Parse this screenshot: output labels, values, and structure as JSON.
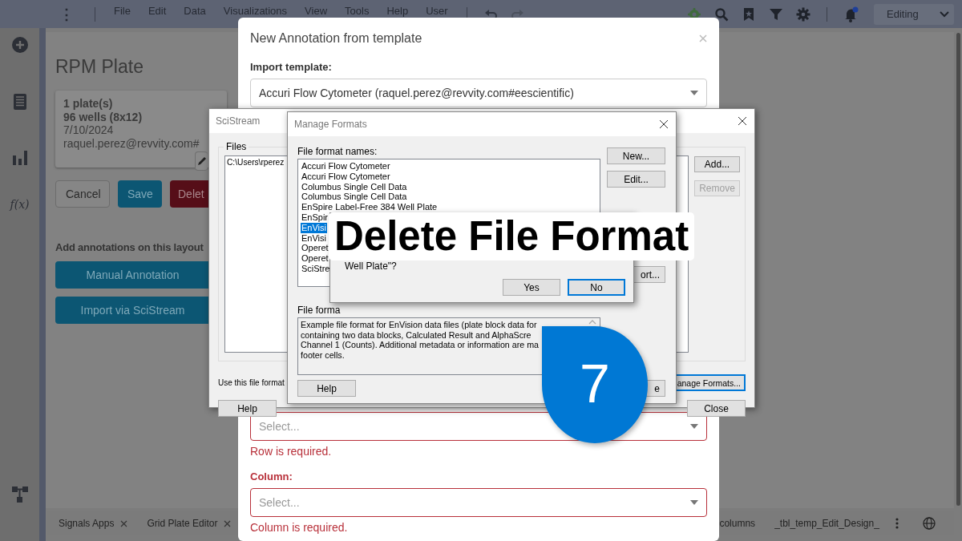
{
  "app": {
    "kebab": "⋮",
    "menu": [
      "File",
      "Edit",
      "Data",
      "Visualizations",
      "View",
      "Tools",
      "Help",
      "User"
    ],
    "mode": "Editing",
    "fx_label": "f(x)",
    "page_title": "RPM Plate",
    "summary": [
      {
        "text": "1 plate(s)",
        "bold": true
      },
      {
        "text": "96 wells (8x12)",
        "bold": true
      },
      {
        "text": "7/10/2024",
        "bold": false
      },
      {
        "text": "raquel.perez@revvity.com#",
        "bold": false
      }
    ],
    "actions": [
      {
        "label": "Cancel",
        "kind": "outline"
      },
      {
        "label": "Save",
        "kind": "primary"
      },
      {
        "label": "Delet",
        "kind": "danger"
      }
    ],
    "annotations_heading": "Add annotations on this layout",
    "annotation_buttons": [
      "Manual Annotation",
      "Import via SciStream"
    ],
    "tabs": [
      {
        "label": "Signals Apps",
        "closable": true
      },
      {
        "label": "Grid Plate Editor",
        "closable": true
      },
      {
        "label": "columns",
        "closable": false
      },
      {
        "label": "_tbl_temp_Edit_Design_",
        "closable": false
      }
    ]
  },
  "template_dialog": {
    "title": "New Annotation from template",
    "import_label": "Import template:",
    "template": "Accuri Flow Cytometer (raquel.perez@revvity.com#eescientific)",
    "fields": [
      {
        "placeholder": "Select...",
        "error": "Row is required."
      },
      {
        "label": "Column:",
        "placeholder": "Select...",
        "error": "Column is required."
      }
    ]
  },
  "scistream": {
    "title": "SciStream",
    "files_label": "Files",
    "files": [
      "C:\\Users\\rperez"
    ],
    "buttons": [
      {
        "label": "Add...",
        "disabled": false
      },
      {
        "label": "Remove",
        "disabled": true
      }
    ],
    "format_label": "Use this file format",
    "manage_button": "anage Formats...",
    "help": "Help",
    "close": "Close"
  },
  "manage_formats": {
    "title": "Manage Formats",
    "names_label": "File format names:",
    "formats": [
      {
        "label": "Accuri Flow Cytometer",
        "selected": false
      },
      {
        "label": "Accuri Flow Cytometer",
        "selected": false
      },
      {
        "label": "Columbus Single Cell Data",
        "selected": false
      },
      {
        "label": "Columbus Single Cell Data",
        "selected": false
      },
      {
        "label": "EnSpire Label-Free 384 Well Plate",
        "selected": false
      },
      {
        "label": "EnSpir",
        "selected": false
      },
      {
        "label": "EnVisi",
        "selected": true
      },
      {
        "label": "EnVisi",
        "selected": false
      },
      {
        "label": "Operet",
        "selected": false
      },
      {
        "label": "Operet",
        "selected": false
      },
      {
        "label": "SciStre",
        "selected": false
      }
    ],
    "buttons": [
      "New...",
      "Edit..."
    ],
    "export_button": "ort...",
    "description_label": "File forma",
    "description": [
      "Example file format for EnVision data files (plate block data for",
      "containing two data blocks, Calculated Result and AlphaScre",
      "Channel 1 (Counts). Additional metadata or information are ma",
      "footer cells."
    ],
    "help": "Help",
    "close": "e"
  },
  "confirm": {
    "message": "Well Plate\"?",
    "buttons": [
      {
        "label": "Yes",
        "focused": false
      },
      {
        "label": "No",
        "focused": true
      }
    ]
  },
  "caption": "Delete File Format",
  "step": "7"
}
